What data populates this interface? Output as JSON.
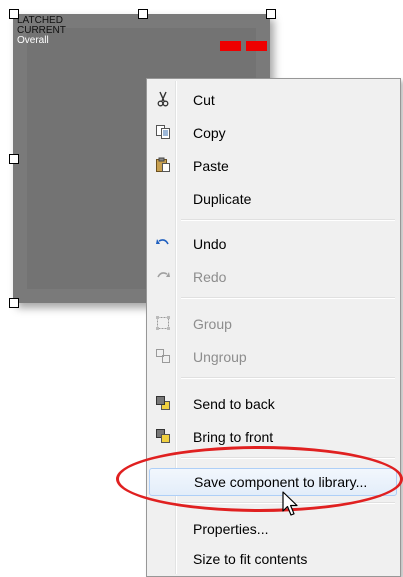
{
  "component": {
    "label_line1": "LATCHED",
    "label_line2": "CURRENT",
    "label_line3": "Overall",
    "background": "#7a7a7a",
    "indicator_color": "#ee0000"
  },
  "context_menu": {
    "items": [
      {
        "label": "Cut",
        "icon": "scissors-icon",
        "enabled": true
      },
      {
        "label": "Copy",
        "icon": "copy-icon",
        "enabled": true
      },
      {
        "label": "Paste",
        "icon": "paste-icon",
        "enabled": true
      },
      {
        "label": "Duplicate",
        "icon": "",
        "enabled": true
      },
      {
        "label": "Undo",
        "icon": "undo-icon",
        "enabled": true
      },
      {
        "label": "Redo",
        "icon": "redo-icon",
        "enabled": false
      },
      {
        "label": "Group",
        "icon": "group-icon",
        "enabled": false
      },
      {
        "label": "Ungroup",
        "icon": "ungroup-icon",
        "enabled": false
      },
      {
        "label": "Send to back",
        "icon": "send-to-back-icon",
        "enabled": true
      },
      {
        "label": "Bring to front",
        "icon": "bring-to-front-icon",
        "enabled": true
      },
      {
        "label": "Save component to library...",
        "icon": "",
        "enabled": true,
        "highlighted": true
      },
      {
        "label": "Properties...",
        "icon": "",
        "enabled": true
      },
      {
        "label": "Size to fit contents",
        "icon": "",
        "enabled": true
      }
    ]
  },
  "annotation_color": "#e02020"
}
